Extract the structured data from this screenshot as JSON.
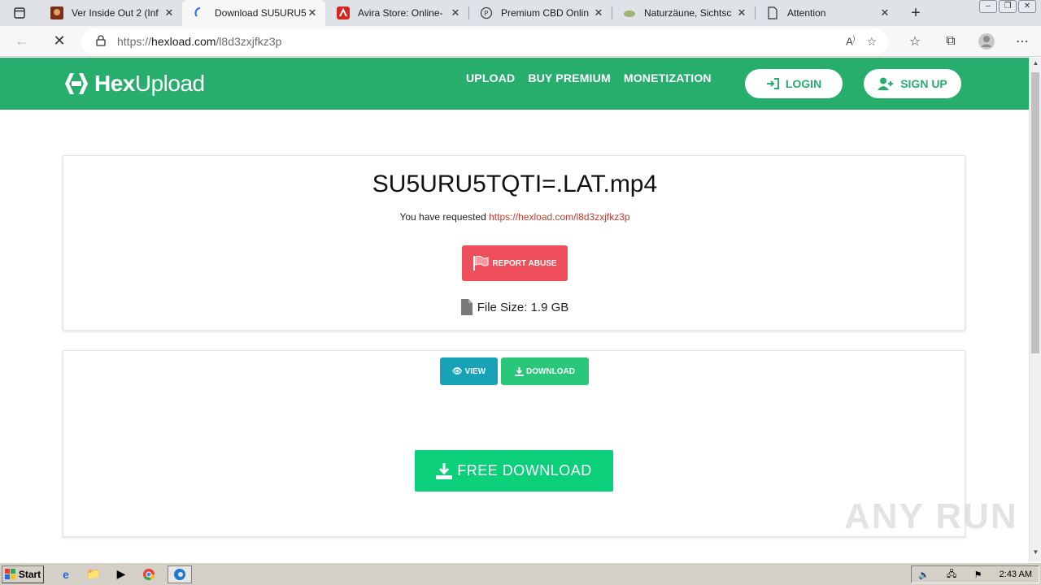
{
  "browser": {
    "tabs": [
      {
        "title": "Ver Inside Out 2 (Inf",
        "active": false
      },
      {
        "title": "Download SU5URU5",
        "active": true
      },
      {
        "title": "Avira Store: Online-",
        "active": false
      },
      {
        "title": "Premium CBD Onlin",
        "active": false
      },
      {
        "title": "Naturzäune, Sichtsc",
        "active": false
      },
      {
        "title": "Attention",
        "active": false
      }
    ],
    "url_prefix": "https://",
    "url_domain": "hexload.com",
    "url_path": "/l8d3zxjfkz3p"
  },
  "site": {
    "logo_bold": "Hex",
    "logo_light": "Upload",
    "menu": [
      "UPLOAD",
      "BUY PREMIUM",
      "MONETIZATION"
    ],
    "login_label": "LOGIN",
    "signup_label": "SIGN UP",
    "colors": {
      "brand": "#28ae6c",
      "report": "#ef4f5b",
      "view": "#17a2b8",
      "download": "#0ccf7a"
    }
  },
  "file": {
    "name": "SU5URU5TQTI=.LAT.mp4",
    "requested_text": "You have requested",
    "requested_link": "https://hexload.com/l8d3zxjfkz3p",
    "report_label": "REPORT ABUSE",
    "size_text": "File Size: 1.9 GB"
  },
  "actions": {
    "view_label": "VIEW",
    "download_label": "DOWNLOAD",
    "free_download_label": "FREE DOWNLOAD"
  },
  "watermark": "ANY RUN",
  "taskbar": {
    "start_label": "Start",
    "clock": "2:43 AM"
  }
}
